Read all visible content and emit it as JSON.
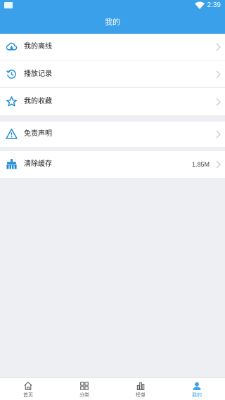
{
  "status_bar": {
    "time": "2:39"
  },
  "app_bar": {
    "title": "我的"
  },
  "menu": {
    "offline": "我的离线",
    "history": "播放记录",
    "favorites": "我的收藏",
    "disclaimer": "免责声明",
    "clear_cache": "清除缓存",
    "cache_size": "1.85M"
  },
  "tabbar": {
    "items": [
      {
        "label": "首页",
        "icon": "home-icon"
      },
      {
        "label": "分类",
        "icon": "grid-icon"
      },
      {
        "label": "榜单",
        "icon": "chart-icon"
      },
      {
        "label": "我的",
        "icon": "user-icon"
      }
    ],
    "active_index": 3
  },
  "colors": {
    "accent": "#3aa0ea",
    "background": "#eeeff3"
  }
}
